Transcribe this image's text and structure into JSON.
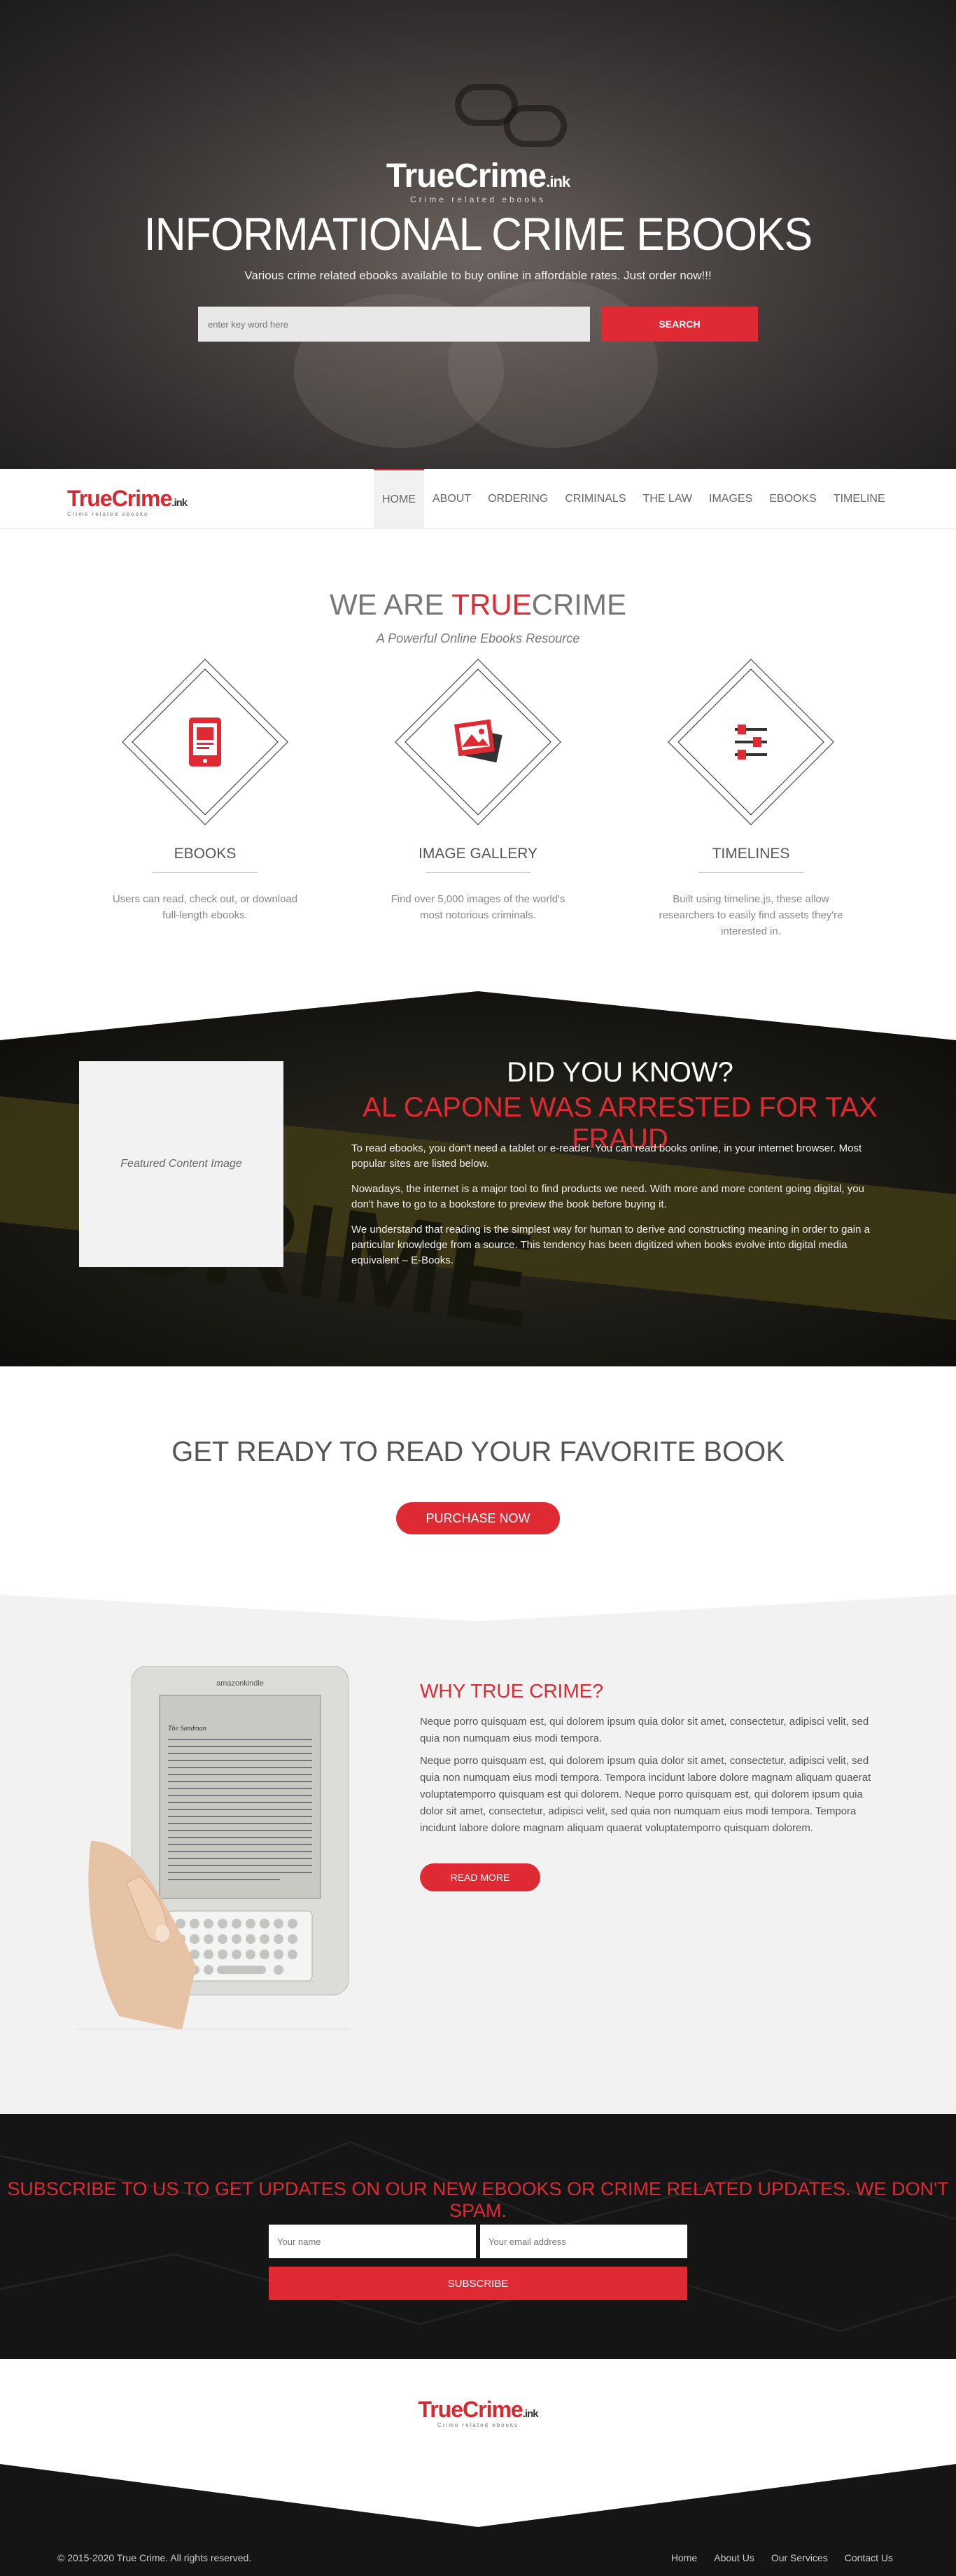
{
  "hero": {
    "logo_word": "TrueCrime",
    "logo_suffix": ".ink",
    "logo_tagline": "Crime related ebooks",
    "title": "INFORMATIONAL CRIME EBOOKS",
    "subtitle": "Various crime related ebooks available to buy online in affordable rates. Just order now!!!",
    "search_placeholder": "enter key word here",
    "search_button": "SEARCH"
  },
  "nav": {
    "logo_word": "TrueCrime",
    "logo_suffix": ".ink",
    "logo_tagline": "Crime related ebooks",
    "items": [
      "HOME",
      "ABOUT",
      "ORDERING",
      "CRIMINALS",
      "THE LAW",
      "IMAGES",
      "EBOOKS",
      "TIMELINE"
    ],
    "active": "HOME"
  },
  "weare": {
    "title_prefix": "WE ARE ",
    "title_accent": "TRUE",
    "title_suffix": "CRIME",
    "tagline": "A Powerful Online Ebooks Resource",
    "features": [
      {
        "icon": "ebook-icon",
        "title": "EBOOKS",
        "text": "Users can read, check out, or download full-length ebooks."
      },
      {
        "icon": "image-gallery-icon",
        "title": "IMAGE GALLERY",
        "text": "Find over 5,000 images of the world's most notorious criminals."
      },
      {
        "icon": "timeline-sliders-icon",
        "title": "TIMELINES",
        "text": "Built using timeline.js, these allow researchers to easily find assets they're interested in."
      }
    ]
  },
  "dyk": {
    "image_label": "Featured Content Image",
    "title": "DID YOU KNOW?",
    "subtitle": "AL CAPONE WAS ARRESTED FOR TAX FRAUD",
    "paragraphs": [
      "To read ebooks, you don't need a tablet or e-reader. You can read books online, in your internet browser. Most popular sites are listed below.",
      "Nowadays, the internet is a major tool to find products we need. With more and more content going digital, you don't have to go to a bookstore to preview the book before buying it.",
      "We understand that reading is the simplest way for human to derive and constructing meaning in order to gain a particular knowledge from a source. This tendency has been digitized when books evolve into digital media equivalent – E-Books."
    ]
  },
  "ready": {
    "title": "GET READY TO READ YOUR FAVORITE BOOK",
    "button": "PURCHASE NOW"
  },
  "why": {
    "title": "WHY TRUE CRIME?",
    "p1": "Neque porro quisquam est, qui dolorem ipsum quia dolor sit amet, consectetur, adipisci velit, sed quia non numquam eius modi tempora.",
    "p2": "Neque porro quisquam est, qui dolorem ipsum quia dolor sit amet, consectetur, adipisci velit, sed quia non numquam eius modi tempora. Tempora incidunt labore dolore magnam aliquam quaerat voluptatemporro quisquam est qui dolorem. Neque porro quisquam est, qui dolorem ipsum quia dolor sit amet, consectetur, adipisci velit, sed quia non numquam eius modi tempora. Tempora incidunt labore dolore magnam aliquam quaerat voluptatemporro quisquam dolorem.",
    "button": "READ MORE",
    "kindle_brand": "amazonkindle",
    "kindle_book_title": "The Sandman"
  },
  "subscribe": {
    "title": "SUBSCRIBE TO US TO GET UPDATES ON OUR NEW EBOOKS OR CRIME RELATED UPDATES. WE DON'T SPAM.",
    "name_placeholder": "Your name",
    "email_placeholder": "Your email address",
    "button": "SUBSCRIBE"
  },
  "footer": {
    "logo_word": "TrueCrime",
    "logo_suffix": ".ink",
    "logo_tagline": "Crime related ebooks",
    "copyright": "© 2015-2020 True Crime. All rights reserved.",
    "links": [
      "Home",
      "About Us",
      "Our Services",
      "Contact Us"
    ]
  },
  "colors": {
    "accent": "#df2a34",
    "dark": "#151515"
  }
}
